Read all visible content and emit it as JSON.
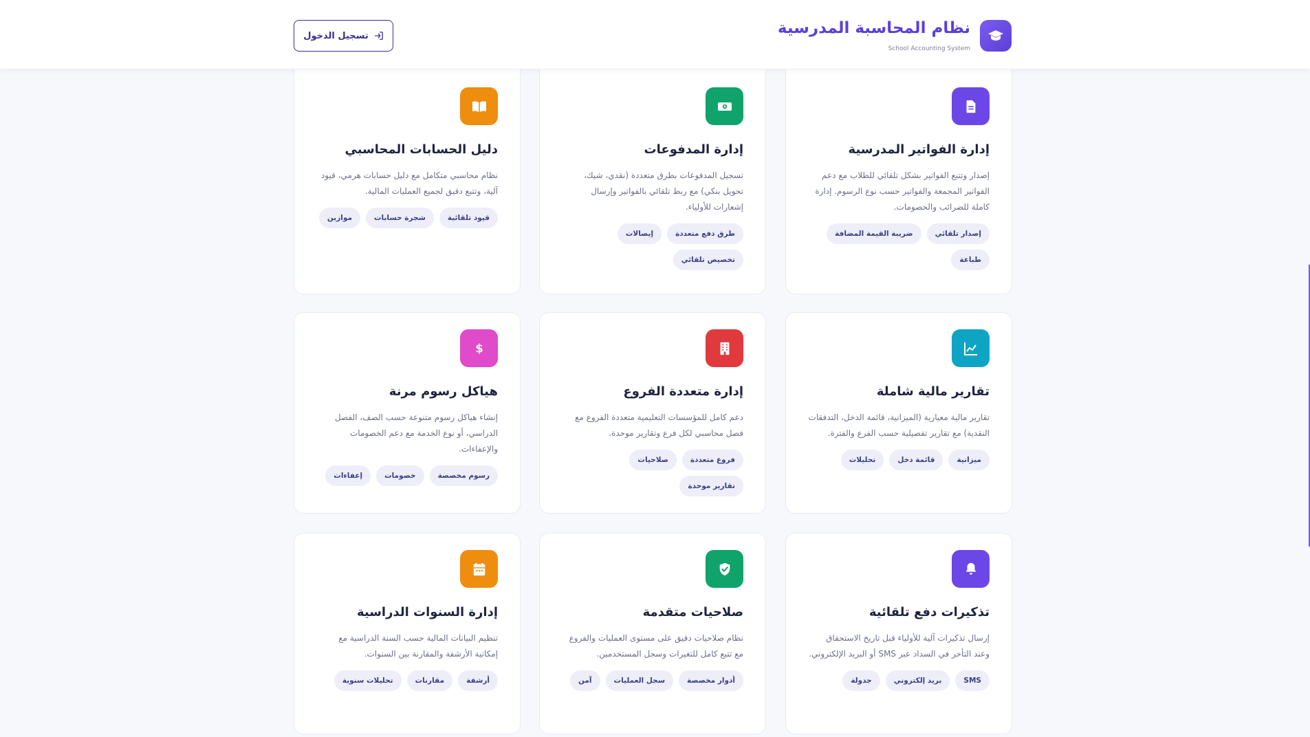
{
  "header": {
    "title": "نظام المحاسبة المدرسية",
    "subtitle": "School Accounting System",
    "login_label": "تسجيل الدخول"
  },
  "colors": {
    "brand": "#5b3fd9",
    "purple": "#6c47e8",
    "green": "#10a36b",
    "orange": "#ef8d0e",
    "teal": "#0ea5c4",
    "red": "#e0393e",
    "pink": "#e04bc9"
  },
  "features": [
    {
      "icon": "document-icon",
      "color": "#6c47e8",
      "title": "إدارة الفواتير المدرسية",
      "desc": "إصدار وتتبع الفواتير بشكل تلقائي للطلاب مع دعم الفواتير المجمعة والفواتير حسب نوع الرسوم. إدارة كاملة للضرائب والخصومات.",
      "tags": [
        "إصدار تلقائي",
        "ضريبة القيمة المضافة",
        "طباعة"
      ]
    },
    {
      "icon": "money-icon",
      "color": "#10a36b",
      "title": "إدارة المدفوعات",
      "desc": "تسجيل المدفوعات بطرق متعددة (نقدي، شيك، تحويل بنكي) مع ربط تلقائي بالفواتير وإرسال إشعارات للأولياء.",
      "tags": [
        "طرق دفع متعددة",
        "إيصالات",
        "تخصيص تلقائي"
      ]
    },
    {
      "icon": "book-icon",
      "color": "#ef8d0e",
      "title": "دليل الحسابات المحاسبي",
      "desc": "نظام محاسبي متكامل مع دليل حسابات هرمي، قيود آلية، وتتبع دقيق لجميع العمليات المالية.",
      "tags": [
        "قيود تلقائية",
        "شجرة حسابات",
        "موازين"
      ]
    },
    {
      "icon": "chart-line-icon",
      "color": "#0ea5c4",
      "title": "تقارير مالية شاملة",
      "desc": "تقارير مالية معيارية (الميزانية، قائمة الدخل، التدفقات النقدية) مع تقارير تفصيلية حسب الفرع والفترة.",
      "tags": [
        "ميزانية",
        "قائمة دخل",
        "تحليلات"
      ]
    },
    {
      "icon": "building-icon",
      "color": "#e0393e",
      "title": "إدارة متعددة الفروع",
      "desc": "دعم كامل للمؤسسات التعليمية متعددة الفروع مع فصل محاسبي لكل فرع وتقارير موحدة.",
      "tags": [
        "فروع متعددة",
        "صلاحيات",
        "تقارير موحدة"
      ]
    },
    {
      "icon": "dollar-icon",
      "color": "#e04bc9",
      "title": "هياكل رسوم مرنة",
      "desc": "إنشاء هياكل رسوم متنوعة حسب الصف، الفصل الدراسي، أو نوع الخدمة مع دعم الخصومات والإعفاءات.",
      "tags": [
        "رسوم مخصصة",
        "خصومات",
        "إعفاءات"
      ]
    },
    {
      "icon": "bell-icon",
      "color": "#6c47e8",
      "title": "تذكيرات دفع تلقائية",
      "desc": "إرسال تذكيرات آلية للأولياء قبل تاريخ الاستحقاق وعند التأخر في السداد عبر SMS أو البريد الإلكتروني.",
      "tags": [
        "SMS",
        "بريد إلكتروني",
        "جدولة"
      ]
    },
    {
      "icon": "shield-check-icon",
      "color": "#10a36b",
      "title": "صلاحيات متقدمة",
      "desc": "نظام صلاحيات دقيق على مستوى العمليات والفروع مع تتبع كامل للتغيرات وسجل المستخدمين.",
      "tags": [
        "أدوار مخصصة",
        "سجل العمليات",
        "آمن"
      ]
    },
    {
      "icon": "calendar-icon",
      "color": "#ef8d0e",
      "title": "إدارة السنوات الدراسية",
      "desc": "تنظيم البيانات المالية حسب السنة الدراسية مع إمكانية الأرشفة والمقارنة بين السنوات.",
      "tags": [
        "أرشفة",
        "مقارنات",
        "تحليلات سنوية"
      ]
    }
  ]
}
